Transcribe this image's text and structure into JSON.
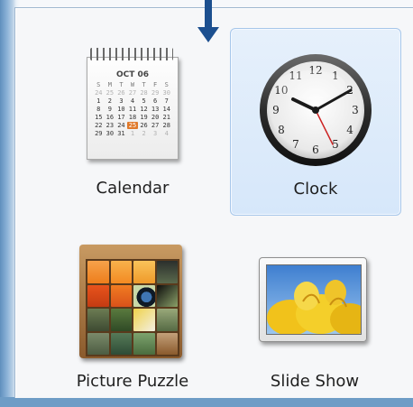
{
  "gadgets": [
    {
      "id": "calendar",
      "label": "Calendar",
      "selected": false
    },
    {
      "id": "clock",
      "label": "Clock",
      "selected": true
    },
    {
      "id": "picture-puzzle",
      "label": "Picture Puzzle",
      "selected": false
    },
    {
      "id": "slide-show",
      "label": "Slide Show",
      "selected": false
    }
  ],
  "calendar": {
    "month": "OCT 06",
    "day_names": [
      "S",
      "M",
      "T",
      "W",
      "T",
      "F",
      "S"
    ],
    "weeks": [
      [
        "24",
        "25",
        "26",
        "27",
        "28",
        "29",
        "30"
      ],
      [
        "1",
        "2",
        "3",
        "4",
        "5",
        "6",
        "7"
      ],
      [
        "8",
        "9",
        "10",
        "11",
        "12",
        "13",
        "14"
      ],
      [
        "15",
        "16",
        "17",
        "18",
        "19",
        "20",
        "21"
      ],
      [
        "22",
        "23",
        "24",
        "25",
        "26",
        "27",
        "28"
      ],
      [
        "29",
        "30",
        "31",
        "1",
        "2",
        "3",
        "4"
      ]
    ],
    "today": "25"
  },
  "clock": {
    "numerals": [
      "12",
      "1",
      "2",
      "3",
      "4",
      "5",
      "6",
      "7",
      "8",
      "9",
      "10",
      "11"
    ]
  },
  "colors": {
    "selection_fill": "#d6e7fa",
    "selection_border": "#a7c7ea",
    "accent_arrow": "#1c4f8f",
    "today_highlight": "#e0792a"
  }
}
